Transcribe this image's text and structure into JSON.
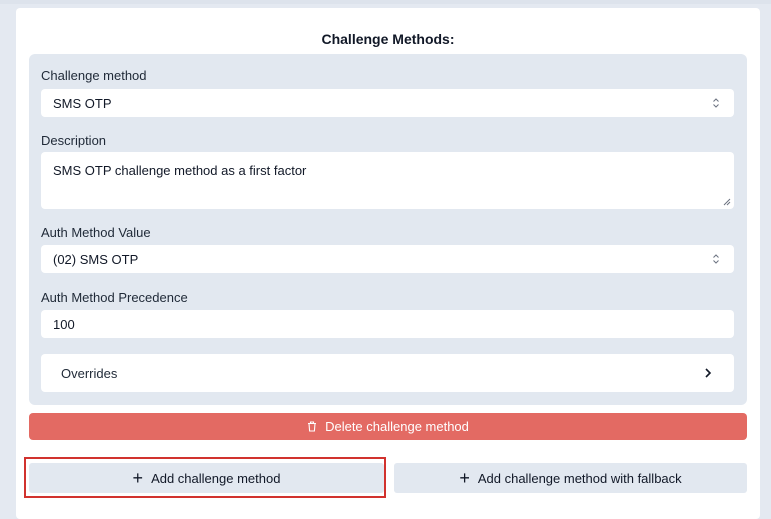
{
  "section": {
    "title": "Challenge Methods:"
  },
  "form": {
    "challenge_method": {
      "label": "Challenge method",
      "value": "SMS OTP"
    },
    "description": {
      "label": "Description",
      "value": "SMS OTP challenge method as a first factor"
    },
    "auth_method_value": {
      "label": "Auth Method Value",
      "value": "(02) SMS OTP"
    },
    "auth_method_precedence": {
      "label": "Auth Method Precedence",
      "value": "100"
    },
    "overrides": {
      "label": "Overrides"
    }
  },
  "actions": {
    "delete_label": "Delete challenge method",
    "add_label": "Add challenge method",
    "add_fallback_label": "Add challenge method with fallback"
  },
  "colors": {
    "delete": "#e36a63",
    "focus_outline": "#d1322e",
    "panel": "#e2e8f0"
  }
}
